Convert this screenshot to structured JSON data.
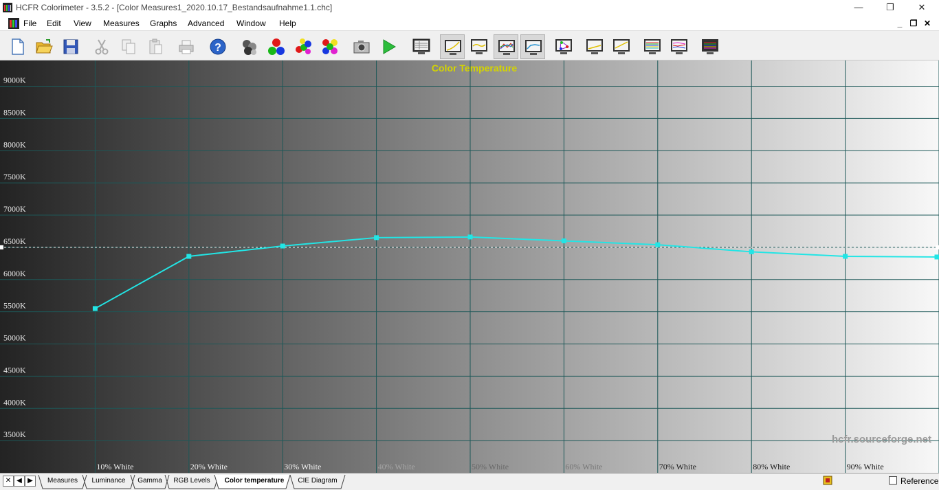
{
  "window": {
    "title": "HCFR Colorimeter - 3.5.2 - [Color Measures1_2020.10.17_Bestandsaufnahme1.1.chc]",
    "minimize": "—",
    "maximize": "❐",
    "close": "✕"
  },
  "menu": {
    "items": [
      "File",
      "Edit",
      "View",
      "Measures",
      "Graphs",
      "Advanced",
      "Window",
      "Help"
    ],
    "mdi_min": "_",
    "mdi_restore": "❐",
    "mdi_close": "✕"
  },
  "toolbar": {
    "buttons": [
      "new-document",
      "open-folder",
      "save-disk",
      "cut",
      "copy",
      "paste",
      "print",
      "help",
      "sensor",
      "rgb-balls",
      "color-balls",
      "multi-color-balls",
      "camera",
      "play-measure",
      "view-measures",
      "view-luminance",
      "view-gamma",
      "view-rgb-levels",
      "view-color-temperature",
      "view-cie-diagram",
      "view-near-black",
      "view-near-white",
      "view-saturation-luminance",
      "view-saturation-shift",
      "view-colorchecker"
    ],
    "pressed": [
      "view-luminance",
      "view-rgb-levels",
      "view-color-temperature"
    ]
  },
  "chart": {
    "watermark": "hcfr.sourceforge.net",
    "reference_line": 6500,
    "line_color": "#22e5e5",
    "title_color": "#d4d400"
  },
  "chart_data": {
    "type": "line",
    "title": "Color Temperature",
    "xlabel": "",
    "ylabel": "",
    "ylim": [
      3000,
      9400
    ],
    "yticks": [
      3500,
      4000,
      4500,
      5000,
      5500,
      6000,
      6500,
      7000,
      7500,
      8000,
      8500,
      9000
    ],
    "ytick_labels": [
      "3500K",
      "4000K",
      "4500K",
      "5000K",
      "5500K",
      "6000K",
      "6500K",
      "7000K",
      "7500K",
      "8000K",
      "8500K",
      "9000K"
    ],
    "categories": [
      "",
      "10% White",
      "20% White",
      "30% White",
      "40% White",
      "50% White",
      "60% White",
      "70% White",
      "80% White",
      "90% White",
      ""
    ],
    "series": [
      {
        "values": [
          null,
          5550,
          6360,
          6520,
          6650,
          6660,
          6600,
          6540,
          6430,
          6360,
          6350
        ]
      }
    ],
    "grid": true
  },
  "statusbar": {
    "nav": [
      "✕",
      "◀",
      "▶"
    ],
    "tabs": [
      "Measures",
      "Luminance",
      "Gamma",
      "RGB Levels",
      "Color temperature",
      "CIE Diagram"
    ],
    "active_tab": "Color temperature",
    "reference_label": "Reference"
  }
}
